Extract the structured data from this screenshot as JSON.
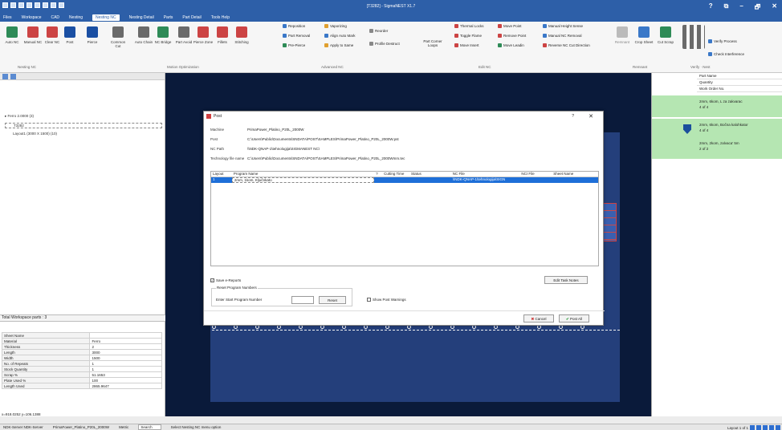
{
  "window": {
    "title": "[T3282] - SigmaNEST X1.7",
    "controls": [
      "?",
      "⧉",
      "–",
      "🗗",
      "✕"
    ]
  },
  "menu": [
    "Files",
    "Workspace",
    "CAD",
    "Nesting",
    "Nesting NC",
    "Nesting Detail",
    "Parts",
    "Part Detail",
    "Tools Help"
  ],
  "ribbon": {
    "buttons": [
      {
        "label": "Auto NC",
        "color": "#2e8b57"
      },
      {
        "label": "Manual NC",
        "color": "#c44"
      },
      {
        "label": "Clear NC",
        "color": "#c44"
      },
      {
        "label": "Post",
        "color": "#1a4fa3"
      },
      {
        "label": "Pierce",
        "color": "#1a4fa3"
      },
      {
        "label": "Common Cut",
        "color": "#6a6a6a"
      },
      {
        "label": "Auto Chain",
        "color": "#6a6a6a"
      },
      {
        "label": "NC Bridge",
        "color": "#2e8b57"
      },
      {
        "label": "Part Avoid",
        "color": "#6a6a6a"
      },
      {
        "label": "Pierce Zone",
        "color": "#c44"
      },
      {
        "label": "Fillets",
        "color": "#c44"
      },
      {
        "label": "Stitching",
        "color": "#c44"
      }
    ],
    "groups": {
      "nesting_nc": "Nesting NC",
      "motion": "Motion Optimization",
      "advanced": "Advanced NC",
      "editnc": "Edit NC",
      "remnant": "Remnant",
      "verify": "Verify · Nest"
    },
    "advanced_items": [
      "Reposition",
      "Part Removal",
      "Pre-Pierce",
      "Vaporizing",
      "Align Auto Mark",
      "Apply to Same",
      "Reorder",
      "Profile Destruct"
    ],
    "edit_items": [
      "Part Corner Loops",
      "Thermal Locks",
      "Toggle Flame",
      "Move Insert",
      "Move Point",
      "Remove Point",
      "Move Leadin",
      "Manual Height Sense",
      "Manual NC Removal",
      "Reverse NC Cut Direction"
    ],
    "remnant_items": [
      "Remnant",
      "Crop Sheet",
      "Cut Scrap"
    ],
    "verify_items": [
      "Verify Process",
      "Check Interference"
    ]
  },
  "left": {
    "tree": [
      "Ferro 2.0000 (3)",
      "T3282",
      "Layout1 (3000 X 1500) (10)"
    ],
    "workspace_total": "Total Workspace parts : 3",
    "properties": [
      [
        "Sheet Name",
        ""
      ],
      [
        "Material",
        "Ferro"
      ],
      [
        "Thickness",
        "2"
      ],
      [
        "Length",
        "3000"
      ],
      [
        "Width",
        "1500"
      ],
      [
        "No. of Repeats",
        "1"
      ],
      [
        "Stock Quantity",
        "1"
      ],
      [
        "Scrap %",
        "51.1653"
      ],
      [
        "Plate Used %",
        "100"
      ],
      [
        "Length Used",
        "2865.9647"
      ]
    ],
    "coords": "x=918.0252 y=106.1388"
  },
  "right": {
    "headers": [
      "Part Name",
      "Quantity",
      "Work Order No."
    ],
    "rows": [
      {
        "name": "2mm, 6kom, L za zakvarac",
        "qty": "4 of 4"
      },
      {
        "name": "2mm, 6kom, Bočna kalohkator",
        "qty": "4 of 4"
      },
      {
        "name": "2mm, 2kom, zalvaca' 5m",
        "qty": "2 of 2"
      }
    ]
  },
  "dialog": {
    "title": "Post",
    "help": "?",
    "close": "✕",
    "machine_label": "Machine",
    "machine": "PrimaPower_Platino_P20L_2000W",
    "post_label": "Post",
    "post": "C:\\Users\\Public\\Documents\\SNDATA\\POST\\SAMPLES\\PrimaPower_Platino_P20L_2000W.pst",
    "ncpath_label": "NC Path",
    "ncpath": "\\\\NDK-QNAP-1\\tehnologija\\SIGMANEST NC\\",
    "tech_label": "Technology file name",
    "tech": "C:\\Users\\Public\\Documents\\SNDATA\\POST\\SAMPLES\\PrimaPower_Platino_P20L_2000Wmm.tec",
    "columns": [
      "Layout",
      "Program Name",
      "?",
      "Cutting Time",
      "Status",
      "NC File",
      "NCI File",
      "Sheet Name"
    ],
    "row": [
      "1",
      "2mm, 1kom, Ključnkato",
      "",
      "",
      "",
      "\\\\NDK-QNAP-1\\tehnologija\\SIGN",
      "",
      ""
    ],
    "save_reports": "Save e-Reports",
    "save_reports_checked": "✓",
    "reset_group": "Reset Program Numbers",
    "start_label": "Enter Start Program Number",
    "reset_btn": "Reset",
    "show_warnings": "Show Post Warnings",
    "edit_task": "Edit Task Notes",
    "cancel": "Cancel",
    "post_all": "Post All"
  },
  "status": {
    "server": "NDK-Server NDK-Server",
    "machine": "PrimaFower_Platino_P20L_2000W",
    "units": "Metric",
    "search": "Search",
    "hint": "Select Nesting NC menu option",
    "layout": "Layout 1 of 1"
  }
}
